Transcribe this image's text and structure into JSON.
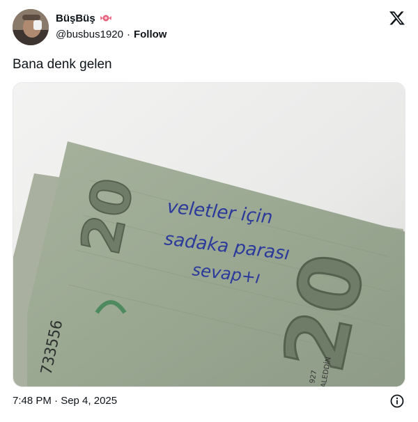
{
  "user": {
    "display_name": "BüşBüş",
    "handle": "@busbus1920",
    "separator": "·",
    "follow_label": "Follow"
  },
  "tweet": {
    "text": "Bana denk gelen",
    "timestamp": "7:48 PM · Sep 4, 2025"
  },
  "banknote": {
    "denomination": "20",
    "serial": "733556",
    "signature_text": "ALEDDİN",
    "year_fragment": "927",
    "handwriting_lines": [
      "veletler için",
      "sadaka parası",
      "sevap+ı"
    ]
  },
  "icons": {
    "verified_emoji": "candy-icon",
    "brand": "x-logo-icon",
    "info": "info-icon"
  },
  "colors": {
    "ink": "#2b3a9a",
    "note_green": "#9aa892",
    "text_primary": "#0f1419"
  }
}
